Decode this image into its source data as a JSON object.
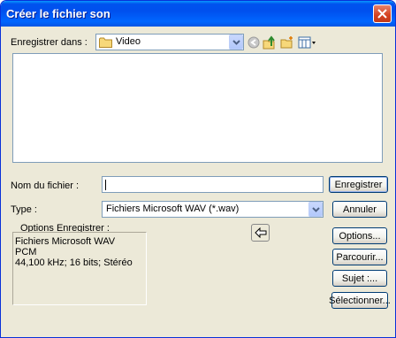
{
  "window": {
    "title": "Créer le fichier son"
  },
  "save_in": {
    "label": "Enregistrer dans :",
    "value": "Video"
  },
  "file_name": {
    "label": "Nom du fichier :",
    "value": ""
  },
  "file_type": {
    "label": "Type :",
    "value": "Fichiers Microsoft WAV (*.wav)"
  },
  "options": {
    "label": "Options Enregistrer :",
    "lines": [
      "Fichiers Microsoft WAV",
      "PCM",
      "44,100 kHz; 16 bits; Stéréo"
    ]
  },
  "buttons": {
    "save": "Enregistrer",
    "cancel": "Annuler",
    "options": "Options...",
    "browse": "Parcourir...",
    "subject": "Sujet :...",
    "select": "Sélectionner..."
  },
  "icons": {
    "close": "close-icon",
    "folder": "folder-icon",
    "back": "back-icon",
    "up": "up-folder-icon",
    "new_folder": "new-folder-icon",
    "views": "views-menu-icon",
    "arrow": "left-arrow-icon"
  },
  "colors": {
    "titlebar": "#0053ee",
    "close": "#d4421f",
    "face": "#ece9d8"
  }
}
